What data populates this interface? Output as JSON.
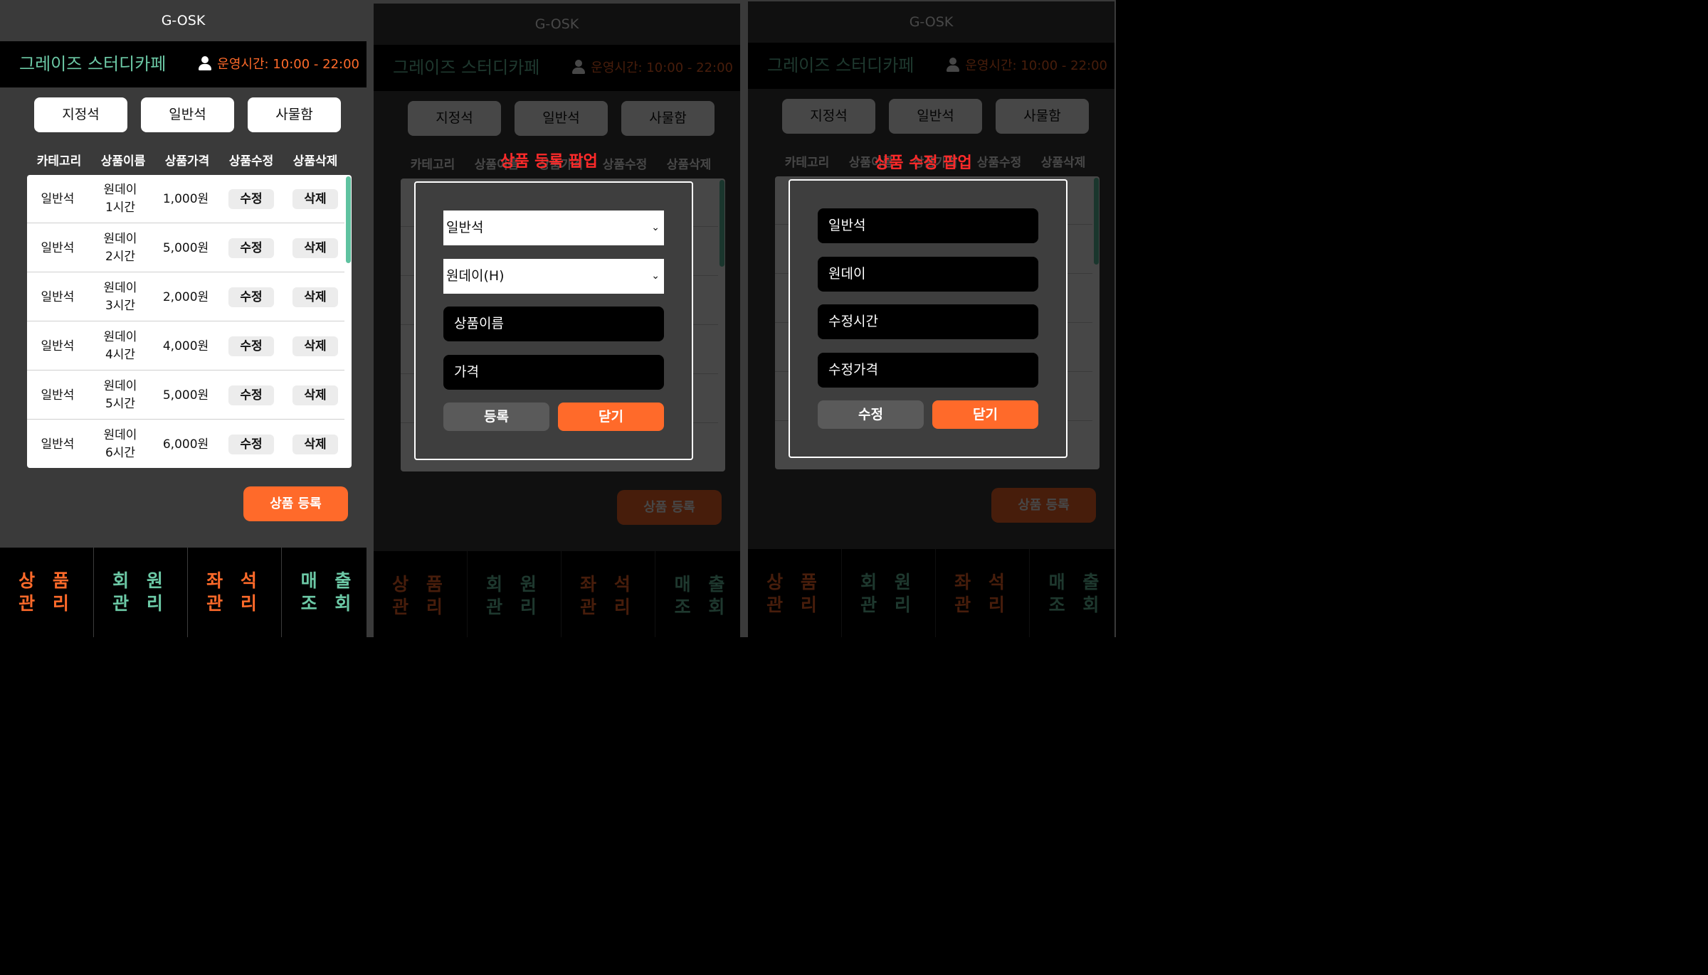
{
  "app": {
    "title": "G-OSK",
    "store_name": "그레이즈 스터디카페",
    "hours": "운영시간: 10:00 - 22:00",
    "tabs": [
      "지정석",
      "일반석",
      "사물함"
    ],
    "columns": [
      "카테고리",
      "상품이름",
      "상품가격",
      "상품수정",
      "상품삭제"
    ],
    "rows": [
      {
        "category": "일반석",
        "name1": "원데이",
        "name2": "1시간",
        "price": "1,000원",
        "edit": "수정",
        "delete": "삭제"
      },
      {
        "category": "일반석",
        "name1": "원데이",
        "name2": "2시간",
        "price": "5,000원",
        "edit": "수정",
        "delete": "삭제"
      },
      {
        "category": "일반석",
        "name1": "원데이",
        "name2": "3시간",
        "price": "2,000원",
        "edit": "수정",
        "delete": "삭제"
      },
      {
        "category": "일반석",
        "name1": "원데이",
        "name2": "4시간",
        "price": "4,000원",
        "edit": "수정",
        "delete": "삭제"
      },
      {
        "category": "일반석",
        "name1": "원데이",
        "name2": "5시간",
        "price": "5,000원",
        "edit": "수정",
        "delete": "삭제"
      },
      {
        "category": "일반석",
        "name1": "원데이",
        "name2": "6시간",
        "price": "6,000원",
        "edit": "수정",
        "delete": "삭제"
      }
    ],
    "register_button": "상품 등록",
    "nav": [
      {
        "label": "상 품\n관 리",
        "color": "#ff6a2a"
      },
      {
        "label": "회 원\n관 리",
        "color": "#6cc9a6"
      },
      {
        "label": "좌 석\n관 리",
        "color": "#ff6a2a"
      },
      {
        "label": "매 출\n조 회",
        "color": "#6cc9a6"
      }
    ]
  },
  "register_popup": {
    "title": "상품 등록 팝업",
    "category_select": "일반석",
    "type_select": "원데이(H)",
    "name_placeholder": "상품이름",
    "price_placeholder": "가격",
    "submit": "등록",
    "close": "닫기"
  },
  "edit_popup": {
    "title": "상품 수정 팝업",
    "category": "일반석",
    "type": "원데이",
    "time_placeholder": "수정시간",
    "price_placeholder": "수정가격",
    "submit": "수정",
    "close": "닫기"
  },
  "colors": {
    "accent_orange": "#ff6a2a",
    "accent_green": "#6cc9a6",
    "popup_title_red": "#ff2a2a"
  }
}
